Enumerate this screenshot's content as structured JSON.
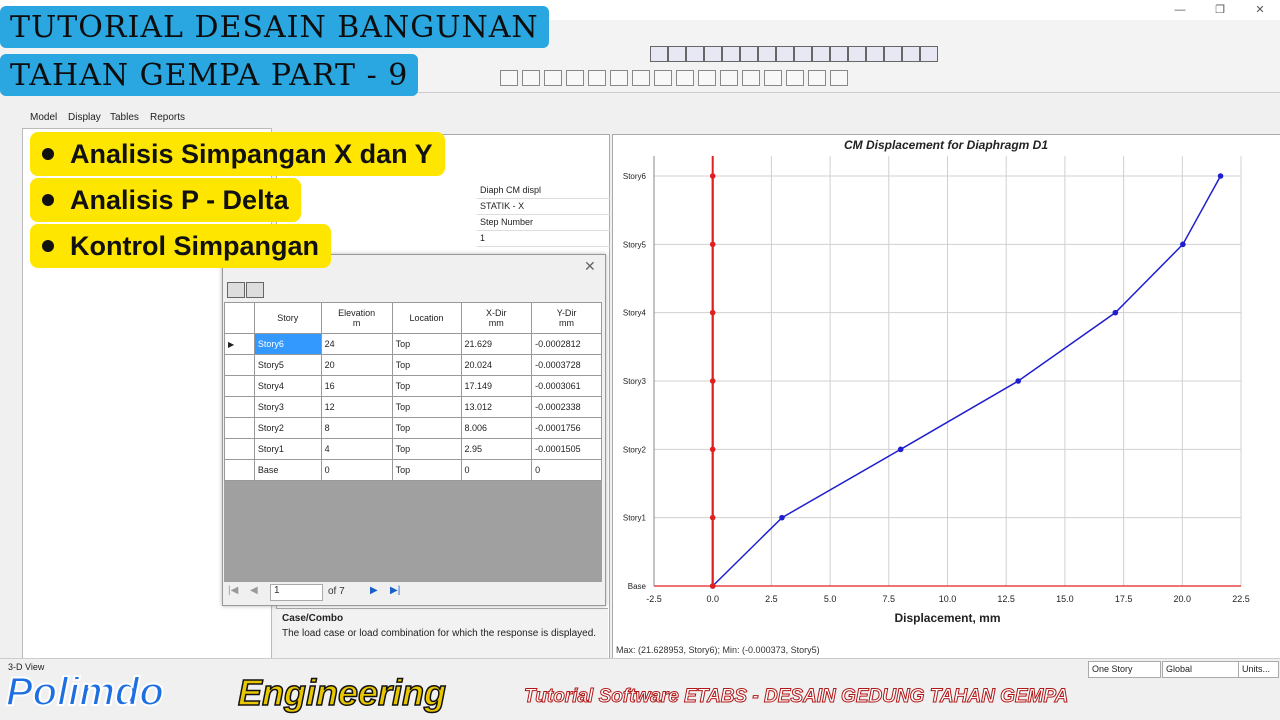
{
  "window": {
    "minimize": "—",
    "restore": "❐",
    "close": "✕"
  },
  "banner": {
    "line1": "TUTORIAL DESAIN BANGUNAN",
    "line2": "TAHAN GEMPA PART - 9"
  },
  "bullets": [
    "Analisis Simpangan X dan Y",
    "Analisis P - Delta",
    "Kontrol Simpangan"
  ],
  "left_tabs": [
    "Model",
    "Display",
    "Tables",
    "Reports"
  ],
  "properties": [
    "Diaph CM displ",
    "STATIK - X",
    "Step Number",
    "1"
  ],
  "description": {
    "title": "Case/Combo",
    "text": "The load case or load combination for which the response is displayed."
  },
  "table": {
    "headers": [
      {
        "main": "Story",
        "unit": ""
      },
      {
        "main": "Elevation",
        "unit": "m"
      },
      {
        "main": "Location",
        "unit": ""
      },
      {
        "main": "X-Dir",
        "unit": "mm"
      },
      {
        "main": "Y-Dir",
        "unit": "mm"
      }
    ],
    "rows": [
      [
        "Story6",
        "24",
        "Top",
        "21.629",
        "-0.0002812"
      ],
      [
        "Story5",
        "20",
        "Top",
        "20.024",
        "-0.0003728"
      ],
      [
        "Story4",
        "16",
        "Top",
        "17.149",
        "-0.0003061"
      ],
      [
        "Story3",
        "12",
        "Top",
        "13.012",
        "-0.0002338"
      ],
      [
        "Story2",
        "8",
        "Top",
        "8.006",
        "-0.0001756"
      ],
      [
        "Story1",
        "4",
        "Top",
        "2.95",
        "-0.0001505"
      ],
      [
        "Base",
        "0",
        "Top",
        "0",
        "0"
      ]
    ],
    "nav": {
      "page": "1",
      "of": "of 7"
    }
  },
  "chart_data": {
    "type": "line",
    "title": "CM Displacement for Diaphragm D1",
    "xlabel": "Displacement, mm",
    "ylabel": "",
    "categories": [
      "Base",
      "Story1",
      "Story2",
      "Story3",
      "Story4",
      "Story5",
      "Story6"
    ],
    "series": [
      {
        "values": [
          0,
          2.95,
          8.006,
          13.012,
          17.149,
          20.024,
          21.629
        ],
        "color": "#1f1fd0"
      },
      {
        "values": [
          0,
          0,
          0,
          0,
          0,
          0,
          0
        ],
        "color": "#e02020"
      }
    ],
    "xlim": [
      -2.5,
      22.5
    ],
    "xticks": [
      "-2.5",
      "0.0",
      "2.5",
      "5.0",
      "7.5",
      "10.0",
      "12.5",
      "15.0",
      "17.5",
      "20.0",
      "22.5"
    ],
    "grid": true
  },
  "maxmin": "Max: (21.628953, Story6);   Min: (-0.000373, Story5)",
  "status": {
    "left": "3-D View",
    "story": "One Story",
    "coord": "Global",
    "units": "Units..."
  },
  "footer": {
    "brand1": "Polimdo",
    "brand2": "Engineering",
    "tagline": "Tutorial Software  ETABS - DESAIN GEDUNG TAHAN GEMPA"
  }
}
